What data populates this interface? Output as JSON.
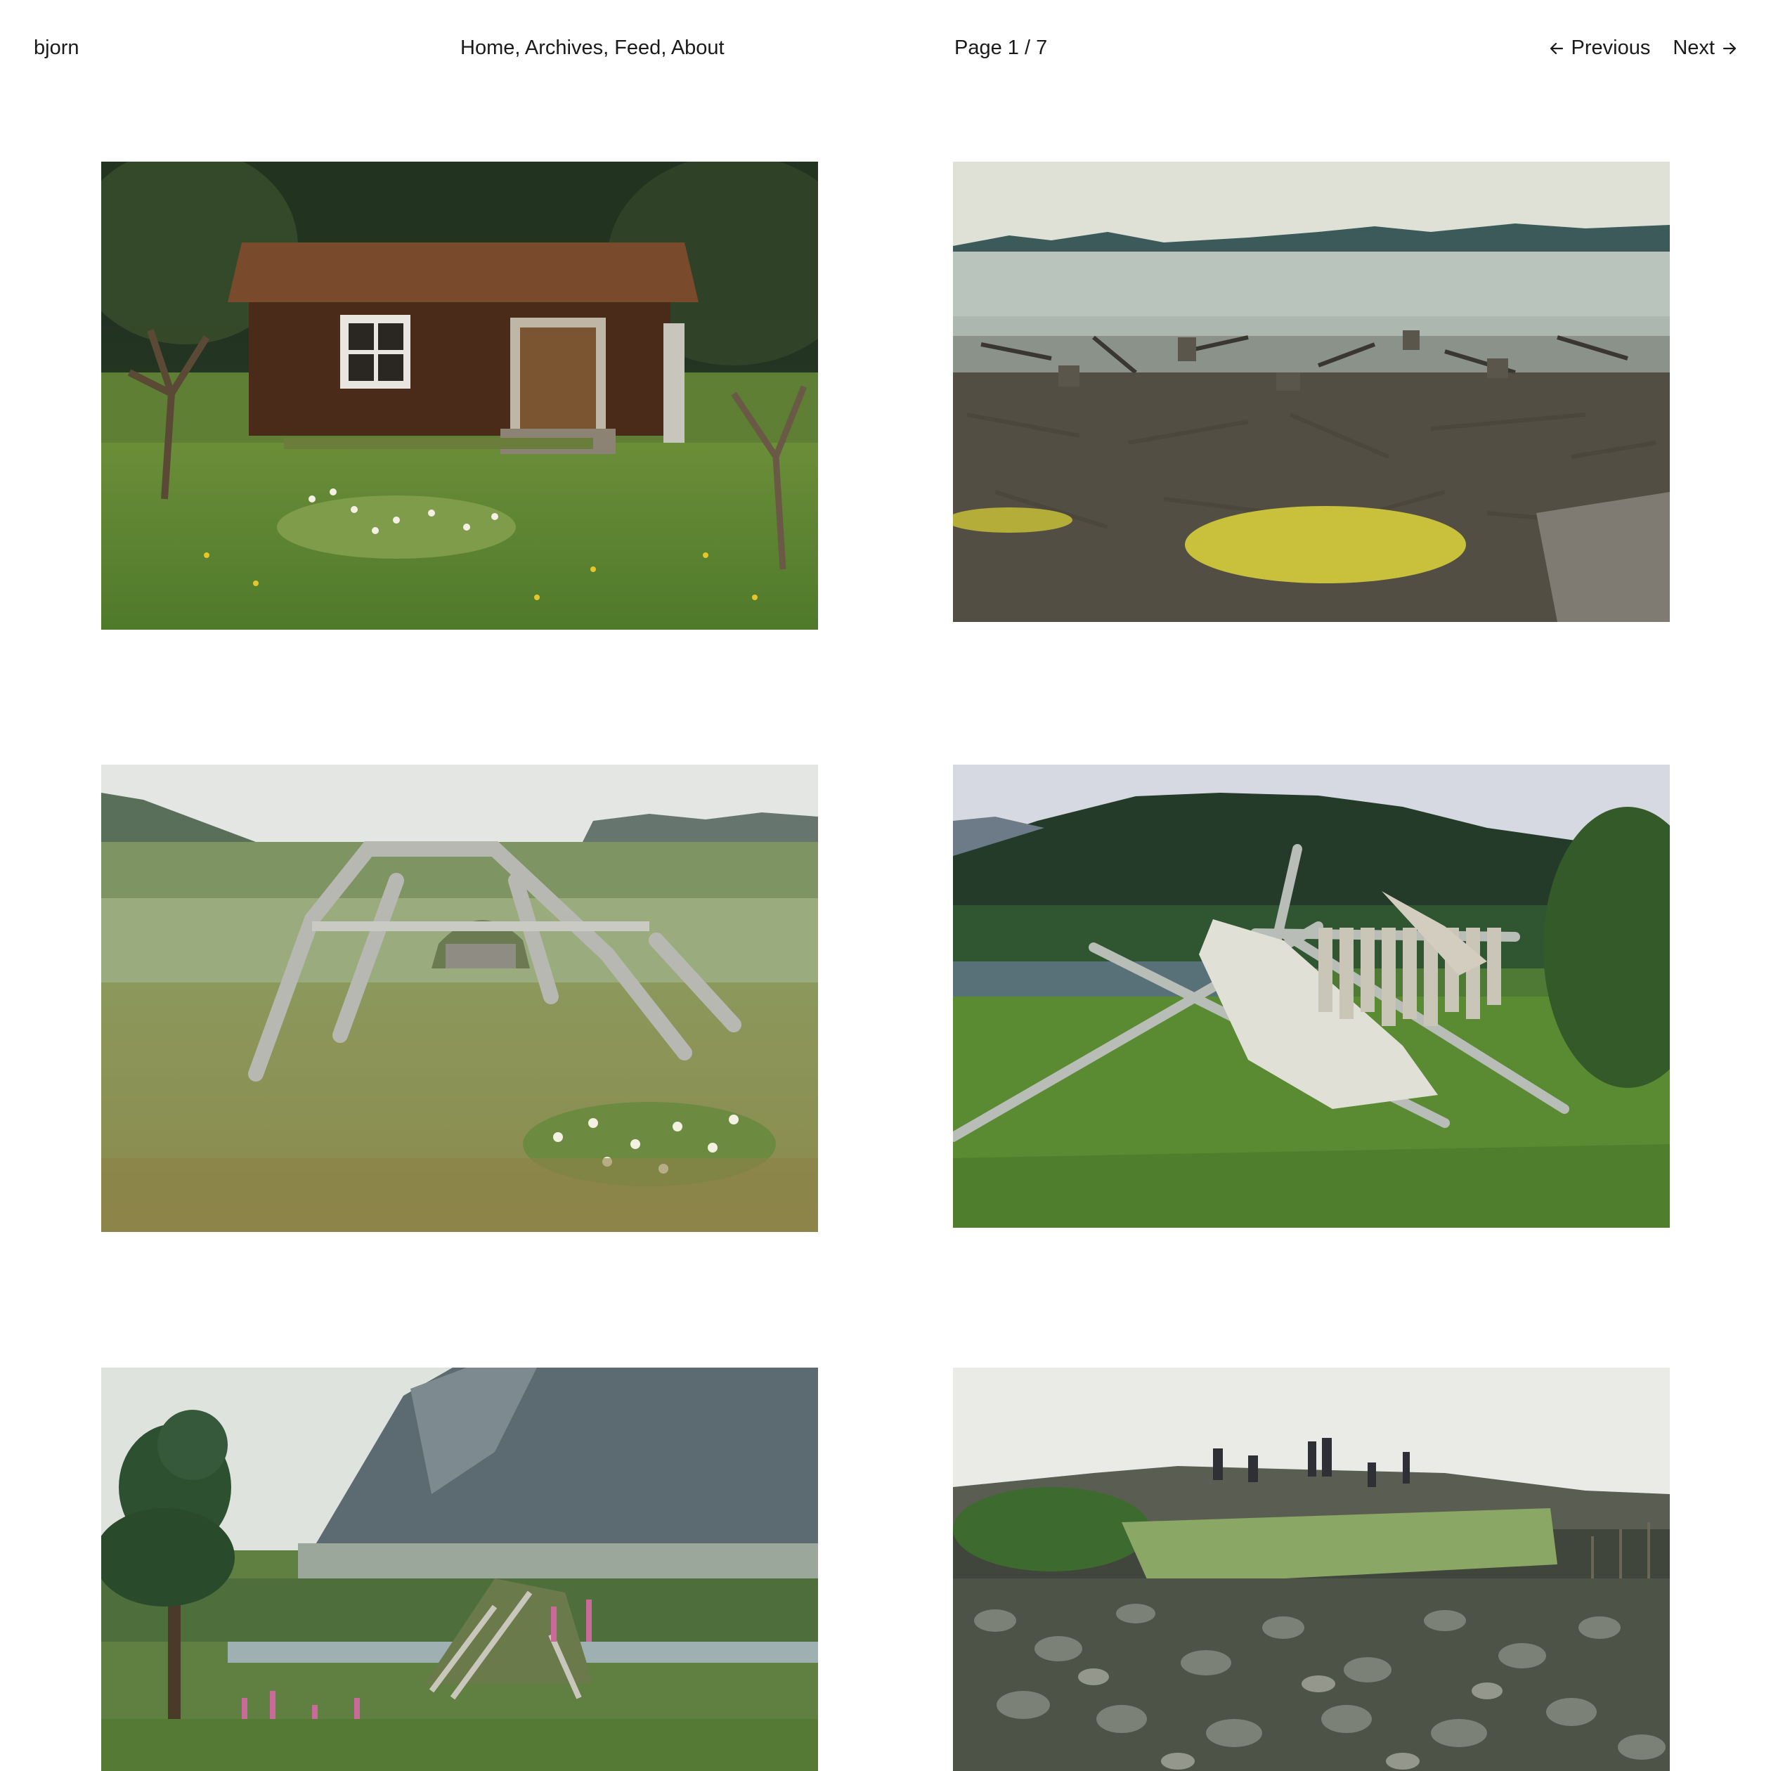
{
  "site": {
    "name": "bjorn"
  },
  "nav": {
    "items": [
      {
        "label": "Home"
      },
      {
        "label": "Archives"
      },
      {
        "label": "Feed"
      },
      {
        "label": "About"
      }
    ],
    "separator": ","
  },
  "pagination": {
    "indicator": "Page 1 / 7",
    "previous_label": "Previous",
    "next_label": "Next",
    "previous_icon": "arrow-left-icon",
    "next_icon": "arrow-right-icon"
  },
  "gallery": {
    "photos": [
      {
        "name": "photo-wooden-cabin",
        "subject": "red wooden cabin with tiled roof in a garden"
      },
      {
        "name": "photo-flooded-stumps",
        "subject": "lake shore with tree stumps and driftwood"
      },
      {
        "name": "photo-arched-frame",
        "subject": "wooden arch frame over a turf hut in a meadow"
      },
      {
        "name": "photo-drying-nets",
        "subject": "fishing nets drying on poles by a river"
      },
      {
        "name": "photo-mountain-hut",
        "subject": "pine tree and turf hut below a mountain"
      },
      {
        "name": "photo-stone-field",
        "subject": "people working on a field of stones"
      }
    ]
  },
  "colors": {
    "text": "#1a1a1a",
    "background": "#ffffff"
  }
}
